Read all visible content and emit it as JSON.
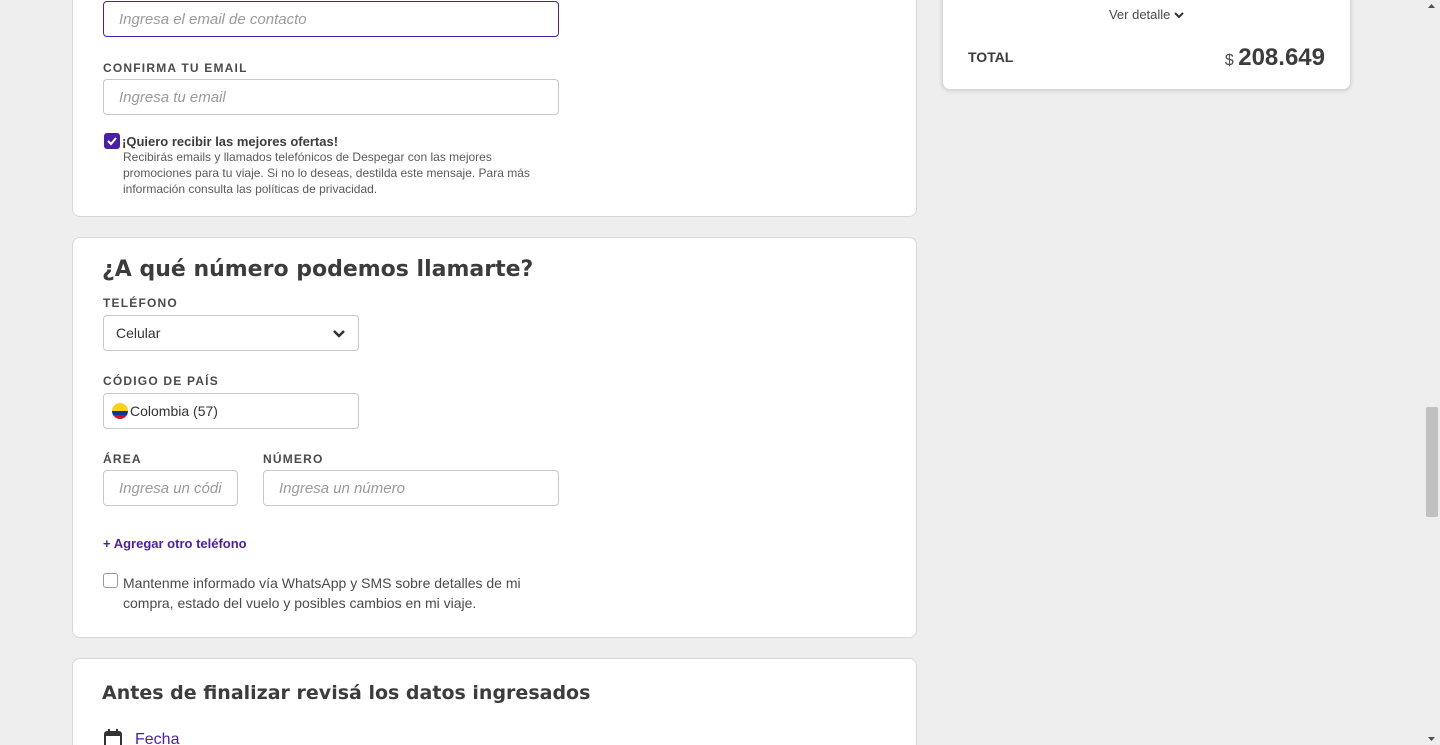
{
  "email_card": {
    "contact_email_placeholder": "Ingresa el email de contacto",
    "confirm_label": "CONFIRMA TU EMAIL",
    "confirm_placeholder": "Ingresa tu email",
    "offers_checked": true,
    "offers_title": "¡Quiero recibir las mejores ofertas!",
    "offers_text": "Recibirás emails y llamados telefónicos de Despegar con las mejores promociones para tu viaje. Si no lo deseas, destilda este mensaje. Para más información consulta las políticas de privacidad."
  },
  "phone_card": {
    "title": "¿A qué número podemos llamarte?",
    "phone_label": "TELÉFONO",
    "phone_type": "Celular",
    "country_label": "CÓDIGO DE PAÍS",
    "country_value": "Colombia (57)",
    "area_label": "ÁREA",
    "area_placeholder": "Ingresa un código",
    "number_label": "NÚMERO",
    "number_placeholder": "Ingresa un número",
    "add_phone_link": "+ Agregar otro teléfono",
    "whatsapp_checked": false,
    "whatsapp_text": "Mantenme informado vía WhatsApp y SMS sobre detalles de mi compra, estado del vuelo y posibles cambios en mi viaje."
  },
  "review_card": {
    "title": "Antes de finalizar revisá los datos ingresados",
    "date_link": "Fecha"
  },
  "total_card": {
    "detail_toggle": "Ver detalle",
    "total_label": "TOTAL",
    "currency": "$",
    "amount": "208.649"
  },
  "colors": {
    "accent": "#4b1fa5",
    "background": "#eeeeee",
    "card": "#ffffff"
  }
}
